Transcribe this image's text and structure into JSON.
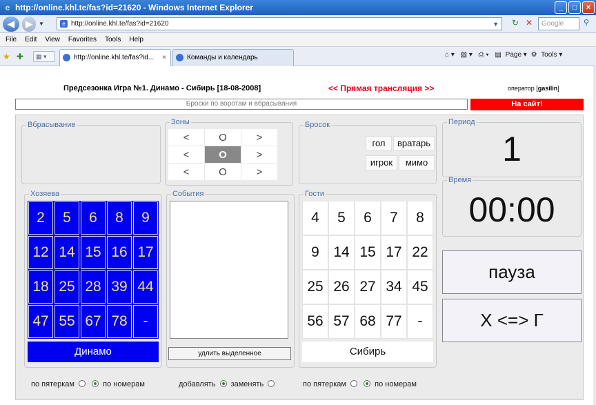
{
  "window": {
    "title": "http://online.khl.te/fas?id=21620 - Windows Internet Explorer",
    "address": "http://online.khl.te/fas?id=21620",
    "search_placeholder": "Google"
  },
  "menu": [
    "File",
    "Edit",
    "View",
    "Favorites",
    "Tools",
    "Help"
  ],
  "tabs": [
    {
      "label": "http://online.khl.te/fas?id...",
      "active": true
    },
    {
      "label": "Команды и календарь",
      "active": false
    }
  ],
  "command_bar": {
    "page": "Page",
    "tools": "Tools"
  },
  "header": {
    "title": "Предсезонка Игра №1. Динамо - Сибирь [18-08-2008]",
    "live": "<< Прямая трансляция >>",
    "operator_prefix": "оператор [",
    "operator_name": "gasilin",
    "operator_suffix": "]"
  },
  "subtitle": "Броски по воротам и вбрасывания",
  "site_button": "На сайт!",
  "legends": {
    "faceoff": "Вбрасывание",
    "zones": "Зоны",
    "shot": "Бросок",
    "period": "Период",
    "time": "Время",
    "home": "Хозяева",
    "events": "События",
    "guests": "Гости"
  },
  "zones": [
    [
      "<",
      "O",
      ">"
    ],
    [
      "<",
      "O",
      ">"
    ],
    [
      "<",
      "O",
      ">"
    ]
  ],
  "shot_buttons": {
    "goal": "гол",
    "goalie": "вратарь",
    "player": "игрок",
    "miss": "мимо"
  },
  "period_value": "1",
  "time_value": "00:00",
  "pause_label": "пауза",
  "swap_label": "Х <=> Г",
  "home": {
    "name": "Динамо",
    "numbers": [
      "2",
      "5",
      "6",
      "8",
      "9",
      "12",
      "14",
      "15",
      "16",
      "17",
      "18",
      "25",
      "28",
      "39",
      "44",
      "47",
      "55",
      "67",
      "78",
      "-"
    ]
  },
  "guests": {
    "name": "Сибирь",
    "numbers": [
      "4",
      "5",
      "6",
      "7",
      "8",
      "9",
      "14",
      "15",
      "17",
      "22",
      "25",
      "26",
      "27",
      "34",
      "45",
      "56",
      "57",
      "68",
      "77",
      "-"
    ]
  },
  "events": {
    "delete_label": "удлить выделенное"
  },
  "radios": {
    "home_by_fives": "по пятеркам",
    "home_by_numbers": "по номерам",
    "add": "добавлять",
    "replace": "заменять",
    "guest_by_fives": "по пятеркам",
    "guest_by_numbers": "по номерам"
  }
}
